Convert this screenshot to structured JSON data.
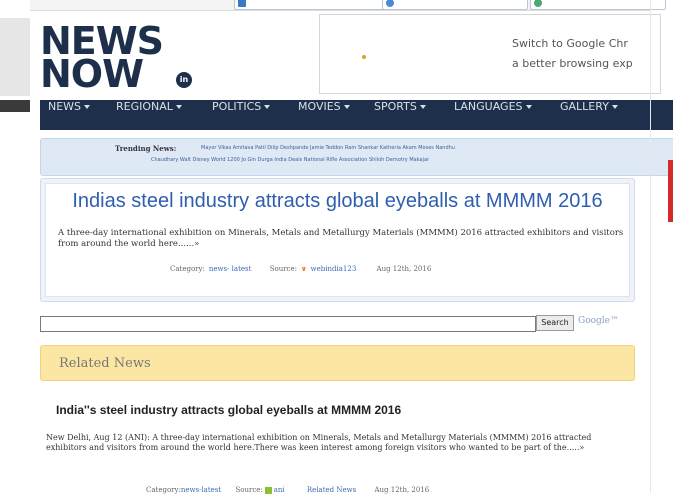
{
  "top_strip": {
    "pills": [
      "",
      "",
      ""
    ]
  },
  "logo": {
    "line1": "NEWS",
    "line2": "NOW",
    "badge": "in"
  },
  "ad": {
    "line1": "Switch to Google Chr",
    "line2": "a better browsing exp"
  },
  "nav": {
    "items": [
      {
        "label": "NEWS"
      },
      {
        "label": "REGIONAL"
      },
      {
        "label": "POLITICS"
      },
      {
        "label": "MOVIES"
      },
      {
        "label": "SPORTS"
      },
      {
        "label": "LANGUAGES"
      },
      {
        "label": "GALLERY"
      }
    ]
  },
  "trending": {
    "label": "Trending News:",
    "line1": "Mayor Vikas  Amitava Patil  Dilip Deshpande  Jamie Teddon  Ram Shankar Katheria  Akam Moses  Nandhu",
    "line2": "Chaudhary  Walt Disney World  1200  Jo Gin  Durga  India Deals  National Rifle Association  Shiloh Demotry Makajar"
  },
  "article": {
    "title": "Indias steel industry attracts global eyeballs at MMMM 2016",
    "description": "A three-day international exhibition on Minerals, Metals and Metallurgy Materials (MMMM) 2016 attracted exhibitors and visitors from around the world here......»",
    "category_label": "Category:",
    "category_value": "news- latest",
    "source_label": "Source:",
    "source_value": "webindia123",
    "date": "Aug 12th, 2016"
  },
  "search": {
    "button_label": "Search",
    "brand": "Google™"
  },
  "related": {
    "header": "Related News",
    "items": [
      {
        "title": "India''s steel industry attracts global eyeballs at MMMM 2016",
        "description": "New Delhi, Aug 12 (ANI): A three-day international exhibition on Minerals, Metals and Metallurgy Materials (MMMM) 2016 attracted exhibitors and visitors from around the world here.There was keen interest among foreign visitors who wanted to be part of the.....»",
        "category_label": "Category:",
        "category_value": "news-latest",
        "source_label": "Source:",
        "source_value": "ani",
        "related_link": "Related News",
        "date": "Aug 12th, 2016"
      }
    ]
  },
  "colors": {
    "nav_bg": "#1d2f4b",
    "title_blue": "#2f5eb1",
    "related_header_bg": "#fbe7a3",
    "trending_bg": "#dfe9f5"
  }
}
